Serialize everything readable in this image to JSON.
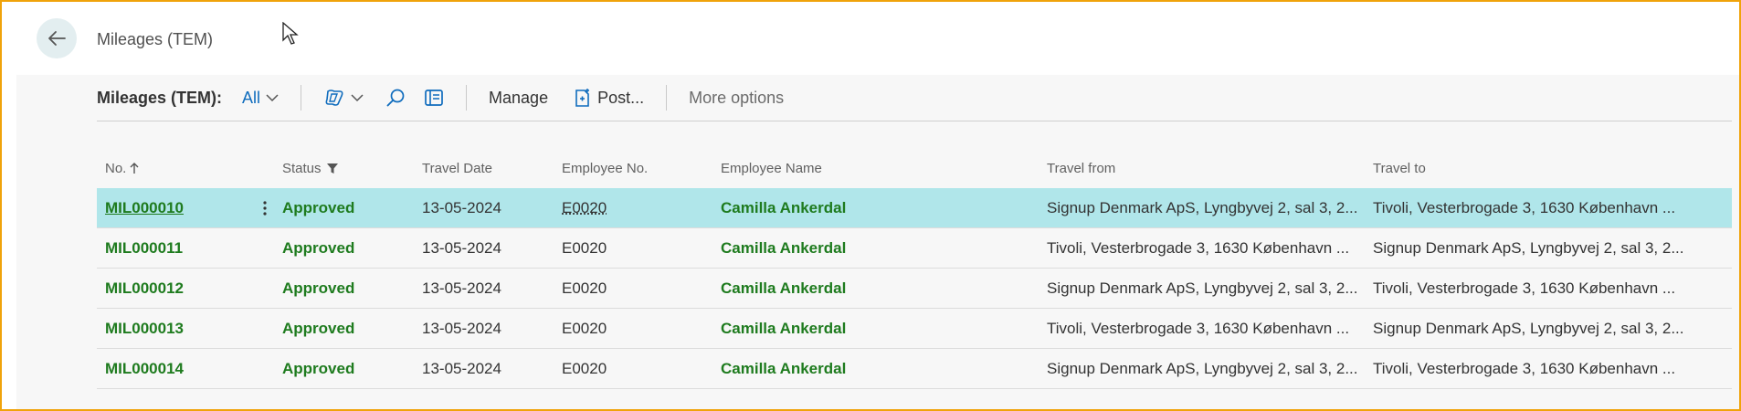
{
  "header": {
    "page_title": "Mileages (TEM)"
  },
  "actionbar": {
    "list_label": "Mileages (TEM):",
    "view_label": "All",
    "manage_label": "Manage",
    "post_label": "Post...",
    "more_label": "More options"
  },
  "table": {
    "columns": {
      "no": "No.",
      "status": "Status",
      "travel_date": "Travel Date",
      "employee_no": "Employee No.",
      "employee_name": "Employee Name",
      "travel_from": "Travel from",
      "travel_to": "Travel to"
    },
    "rows": [
      {
        "no": "MIL000010",
        "status": "Approved",
        "date": "13-05-2024",
        "emp": "E0020",
        "name": "Camilla Ankerdal",
        "from": "Signup Denmark ApS, Lyngbyvej 2, sal 3, 2...",
        "to": "Tivoli, Vesterbrogade 3, 1630 København ..."
      },
      {
        "no": "MIL000011",
        "status": "Approved",
        "date": "13-05-2024",
        "emp": "E0020",
        "name": "Camilla Ankerdal",
        "from": "Tivoli, Vesterbrogade 3, 1630 København ...",
        "to": "Signup Denmark ApS, Lyngbyvej 2, sal 3, 2..."
      },
      {
        "no": "MIL000012",
        "status": "Approved",
        "date": "13-05-2024",
        "emp": "E0020",
        "name": "Camilla Ankerdal",
        "from": "Signup Denmark ApS, Lyngbyvej 2, sal 3, 2...",
        "to": "Tivoli, Vesterbrogade 3, 1630 København ..."
      },
      {
        "no": "MIL000013",
        "status": "Approved",
        "date": "13-05-2024",
        "emp": "E0020",
        "name": "Camilla Ankerdal",
        "from": "Tivoli, Vesterbrogade 3, 1630 København ...",
        "to": "Signup Denmark ApS, Lyngbyvej 2, sal 3, 2..."
      },
      {
        "no": "MIL000014",
        "status": "Approved",
        "date": "13-05-2024",
        "emp": "E0020",
        "name": "Camilla Ankerdal",
        "from": "Signup Denmark ApS, Lyngbyvej 2, sal 3, 2...",
        "to": "Tivoli, Vesterbrogade 3, 1630 København ..."
      }
    ]
  },
  "icons": {
    "back": "arrow-left-icon",
    "copilot": "copilot-icon",
    "search": "search-icon",
    "layout": "filter-pane-icon",
    "post": "post-document-icon",
    "sort": "arrow-up-icon",
    "filter": "funnel-icon",
    "row_menu": "vertical-ellipsis-icon"
  },
  "colors": {
    "accent": "#0f6cbd",
    "selected_row": "#b0e6ea",
    "status_green": "#1e7b1e",
    "frame": "#f0a30a"
  }
}
